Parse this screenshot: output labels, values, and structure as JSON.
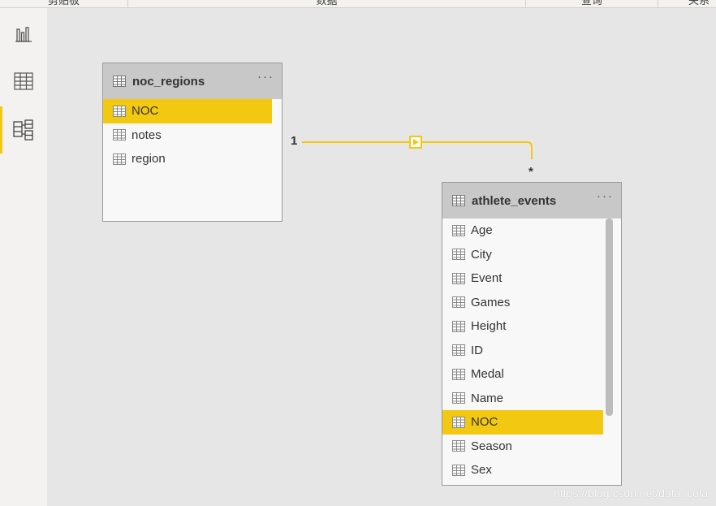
{
  "ribbon": {
    "groups": [
      "剪贴板",
      "数据",
      "查询",
      "关系"
    ]
  },
  "sidebar": {
    "items": [
      {
        "name": "report-view",
        "icon": "bar-chart-icon"
      },
      {
        "name": "data-view",
        "icon": "table-grid-icon"
      },
      {
        "name": "model-view",
        "icon": "model-diagram-icon",
        "active": true
      }
    ],
    "accent": "#f2c811"
  },
  "tables": {
    "noc_regions": {
      "title": "noc_regions",
      "more": "···",
      "fields": [
        "NOC",
        "notes",
        "region"
      ],
      "selected": "NOC"
    },
    "athlete_events": {
      "title": "athlete_events",
      "more": "···",
      "fields": [
        "Age",
        "City",
        "Event",
        "Games",
        "Height",
        "ID",
        "Medal",
        "Name",
        "NOC",
        "Season",
        "Sex"
      ],
      "selected": "NOC"
    }
  },
  "relationship": {
    "from_cardinality": "1",
    "to_cardinality": "*",
    "color": "#f2c811"
  },
  "watermark": "https://blog.csdn.net/data_cola"
}
